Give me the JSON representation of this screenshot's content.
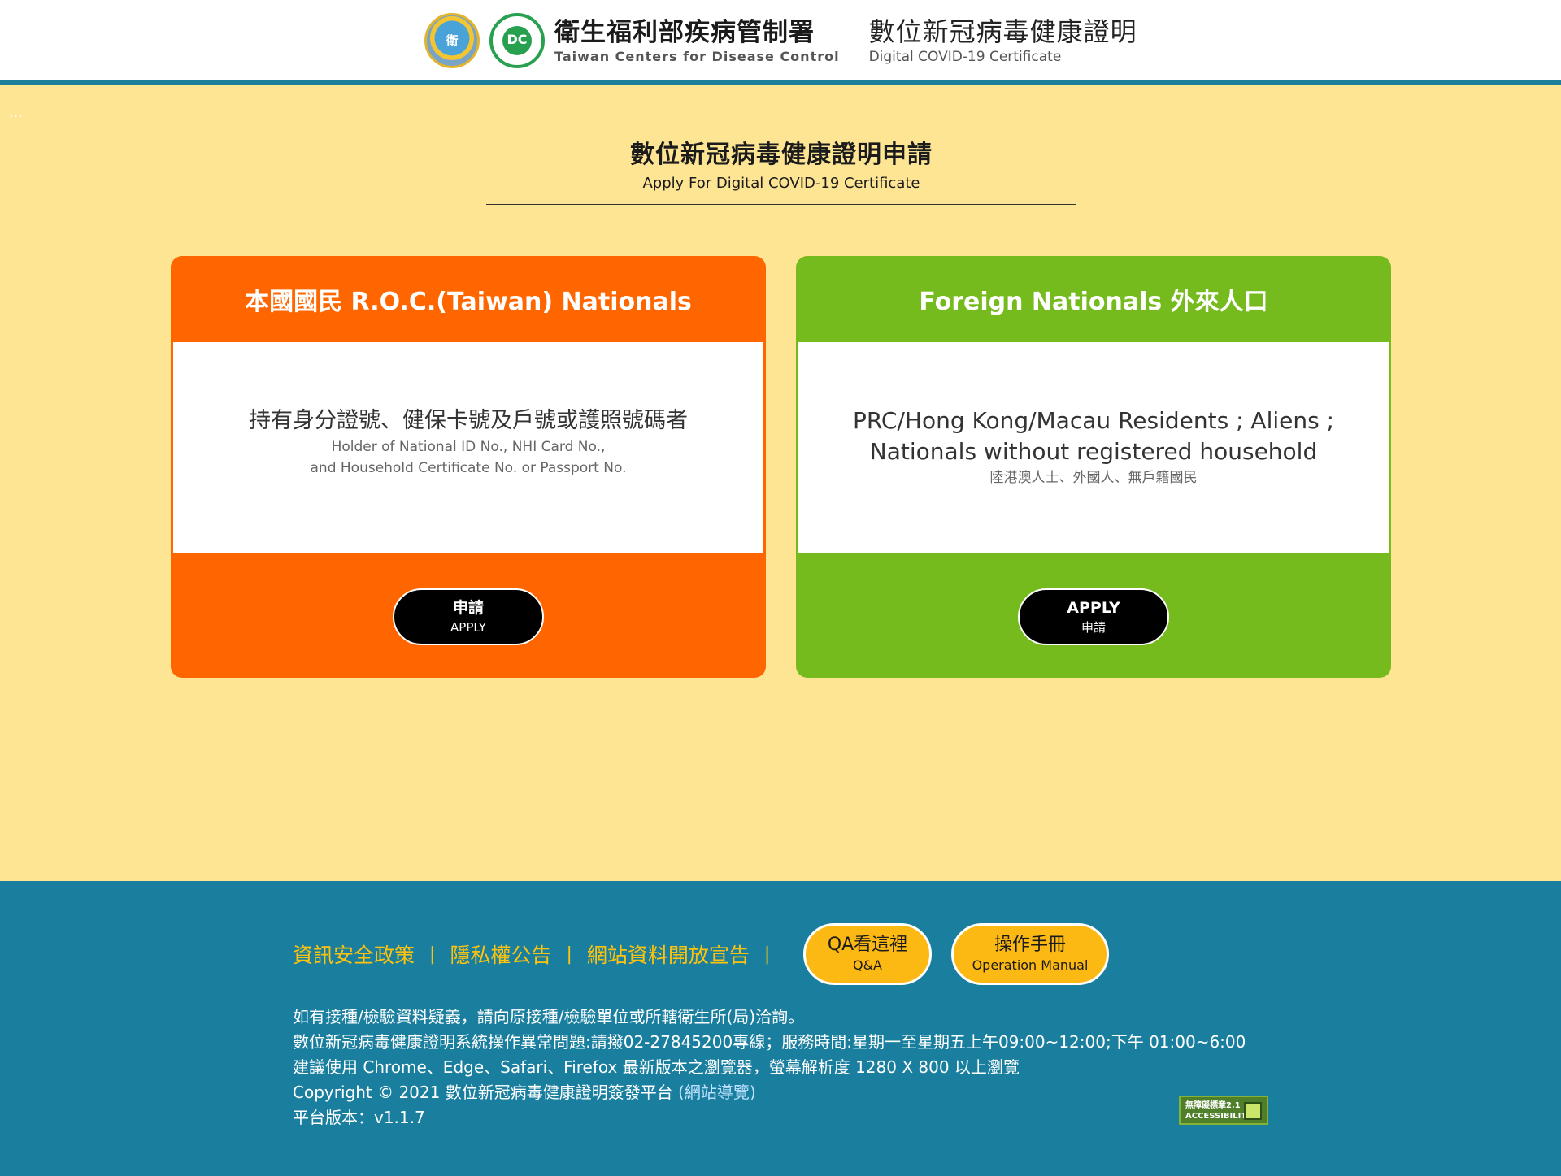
{
  "header": {
    "logo_moh_text": "衛",
    "logo_cdc_text": "DC",
    "org_name_zh": "衛生福利部疾病管制署",
    "org_name_en": "Taiwan Centers for Disease Control",
    "cert_title_zh": "數位新冠病毒健康證明",
    "cert_title_en": "Digital COVID-19 Certificate"
  },
  "dots": "...",
  "page_title": {
    "zh": "數位新冠病毒健康證明申請",
    "en": "Apply For Digital COVID-19 Certificate"
  },
  "cards": {
    "roc": {
      "title": "本國國民 R.O.C.(Taiwan) Nationals",
      "desc_main": "持有身分證號、健保卡號及戶號或護照號碼者",
      "desc_sub1": "Holder of National ID No., NHI Card No.,",
      "desc_sub2": "and Household Certificate No. or Passport No.",
      "btn_line1": "申請",
      "btn_line2": "APPLY"
    },
    "foreign": {
      "title": "Foreign Nationals 外來人口",
      "desc_main1": "PRC/Hong Kong/Macau Residents ; Aliens ;",
      "desc_main2": "Nationals without registered household",
      "desc_sub": "陸港澳人士、外國人、無戶籍國民",
      "btn_line1": "APPLY",
      "btn_line2": "申請"
    }
  },
  "footer": {
    "links": [
      "資訊安全政策",
      "隱私權公告",
      "網站資料開放宣告"
    ],
    "separator": "|",
    "qa_btn": {
      "line1": "QA看這裡",
      "line2": "Q&A"
    },
    "manual_btn": {
      "line1": "操作手冊",
      "line2": "Operation Manual"
    },
    "line1": "如有接種/檢驗資料疑義，請向原接種/檢驗單位或所轄衛生所(局)洽詢。",
    "line2": "數位新冠病毒健康證明系統操作異常問題:請撥02-27845200專線；服務時間:星期一至星期五上午09:00~12:00;下午 01:00~6:00",
    "line3": "建議使用 Chrome、Edge、Safari、Firefox 最新版本之瀏覽器，螢幕解析度 1280 X 800 以上瀏覽",
    "copyright": "Copyright © 2021 數位新冠病毒健康證明簽發平台",
    "sitemap": "(網站導覽)",
    "version": "平台版本：v1.1.7",
    "accessibility_line1": "無障礙標章2.1",
    "accessibility_line2": "ACCESSIBILITY"
  },
  "colors": {
    "page_bg": "#fee594",
    "header_border": "#1b7f99",
    "roc_card": "#ff6600",
    "foreign_card": "#76bb1d",
    "footer_bg": "#1a7f9f",
    "footer_link": "#fec30e",
    "pill_bg": "#fdb913"
  }
}
